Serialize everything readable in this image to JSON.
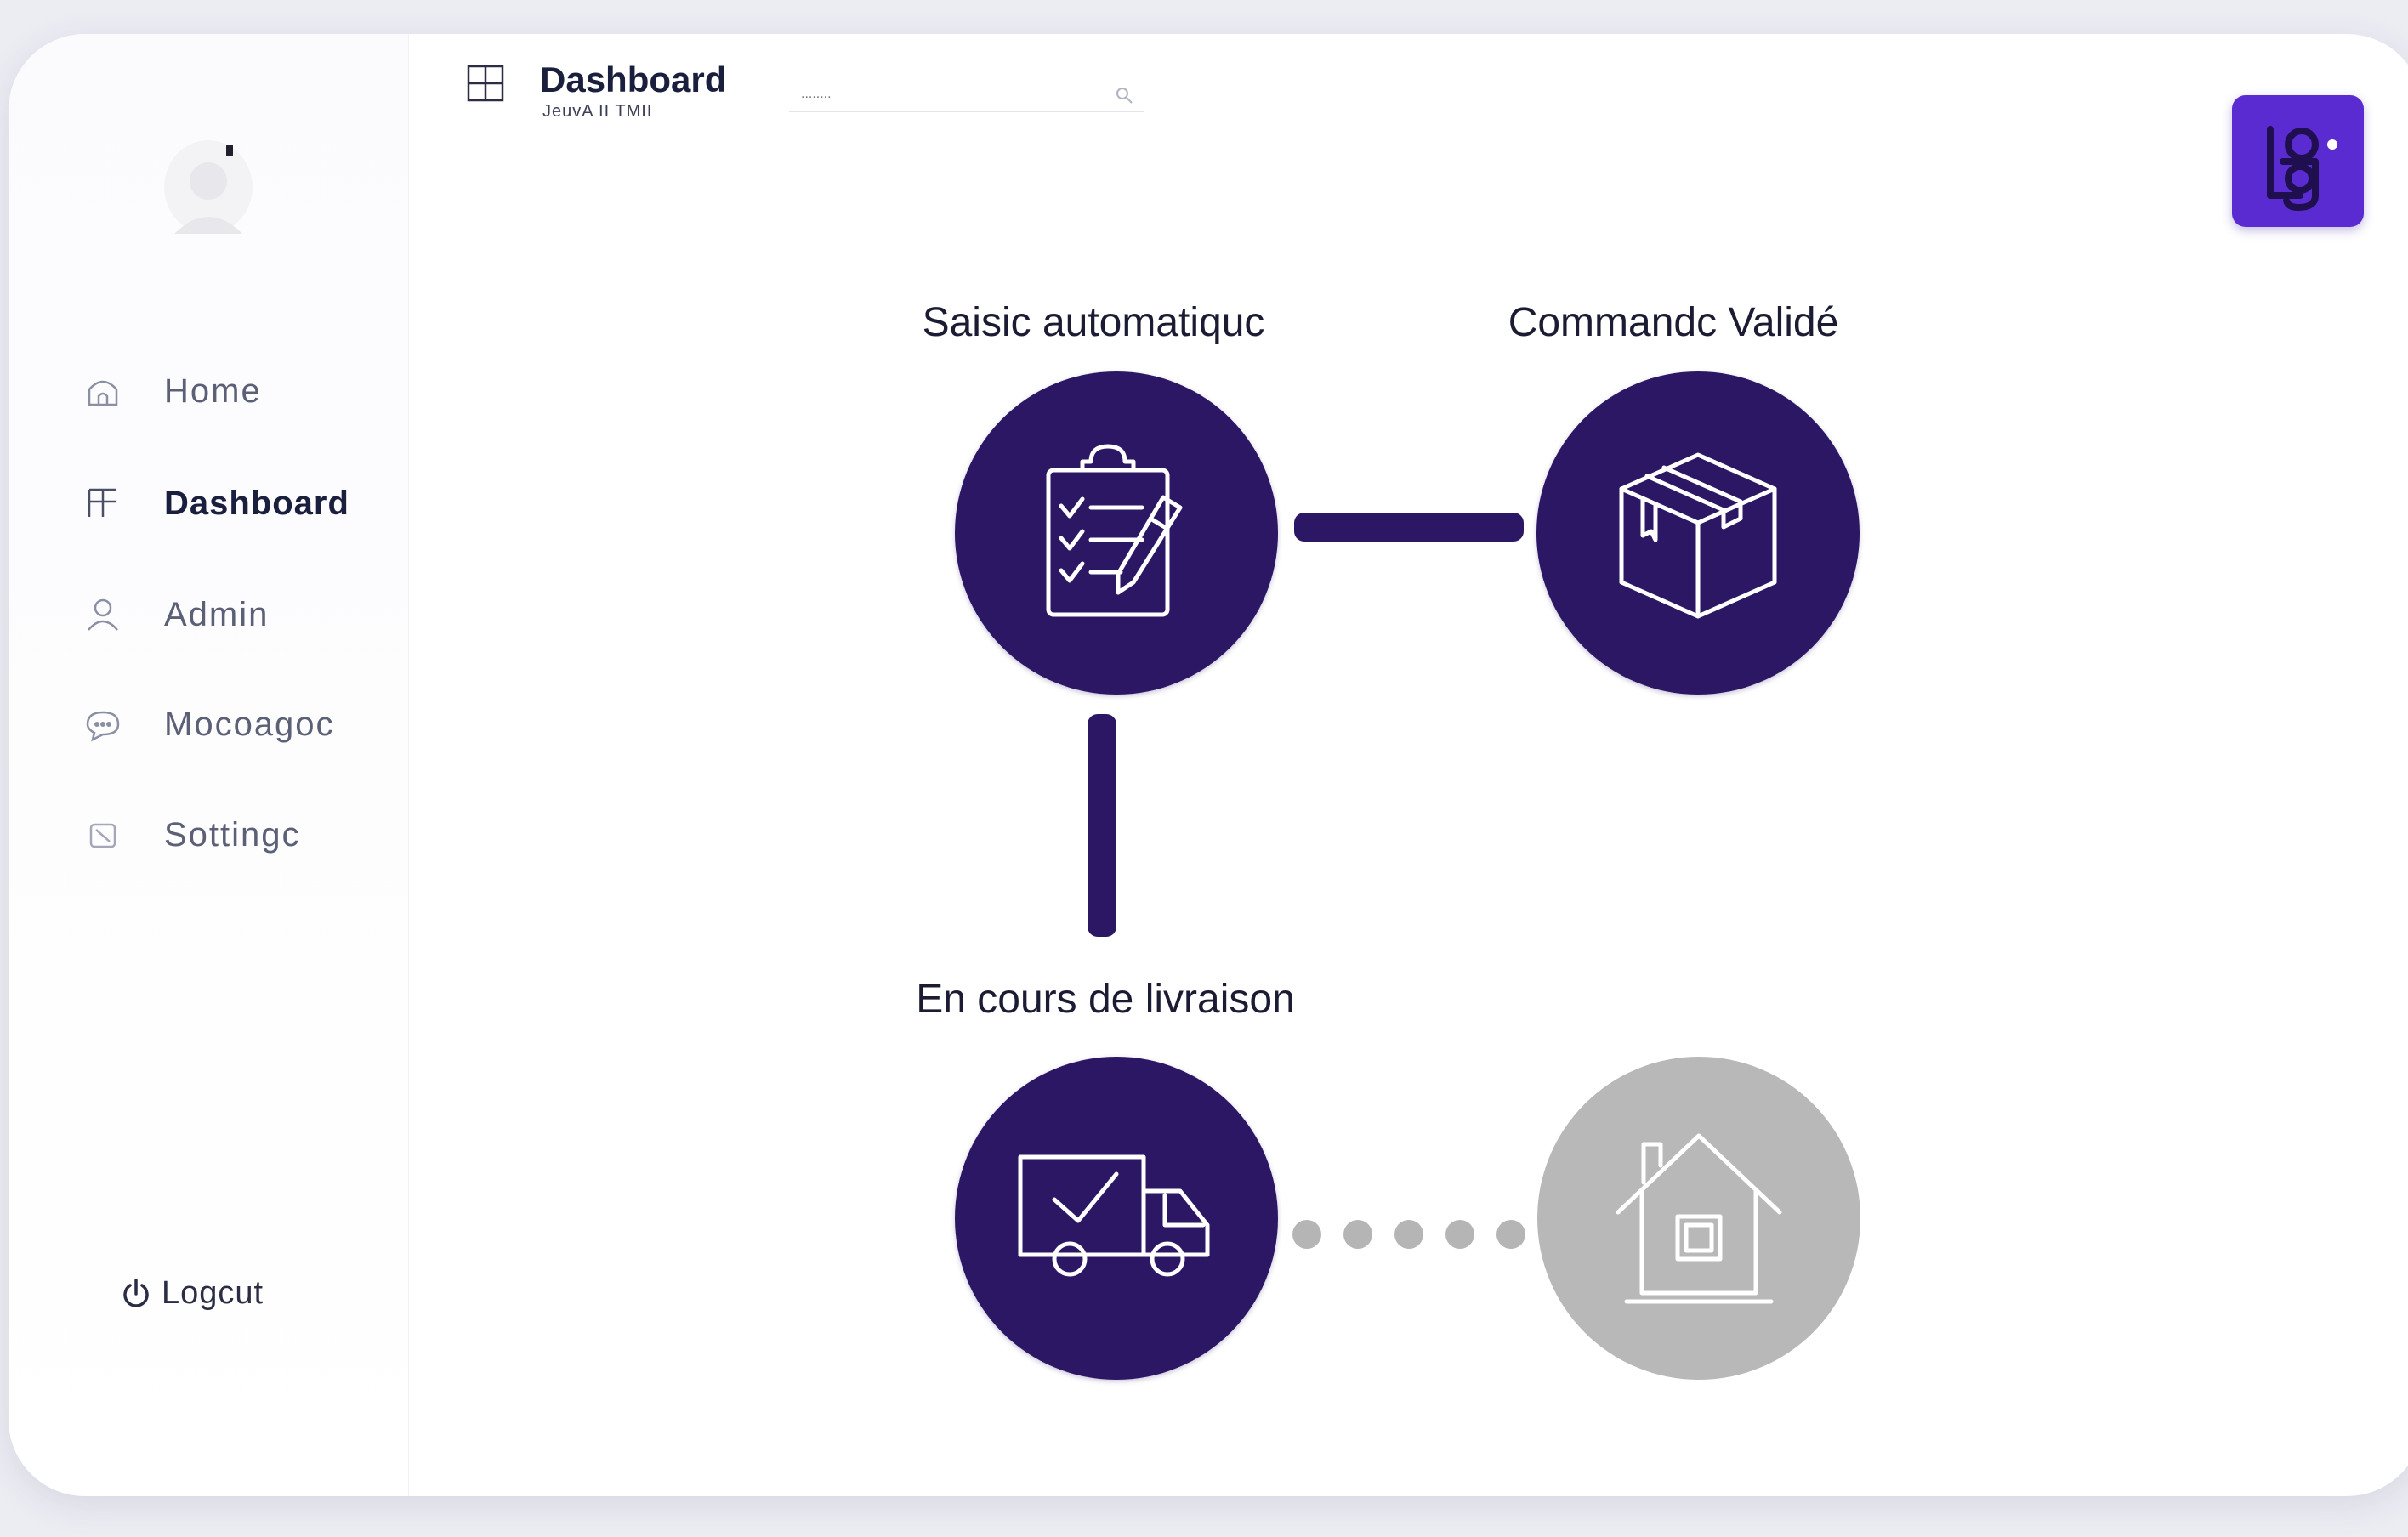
{
  "header": {
    "title": "Dashboard",
    "subtitle": "JeuvA II TMII",
    "search_placeholder": "........"
  },
  "sidebar": {
    "items": [
      {
        "label": "Home",
        "icon": "home-icon"
      },
      {
        "label": "Dashboard",
        "icon": "dashboard-grid-icon",
        "active": true
      },
      {
        "label": "Admin",
        "icon": "user-icon"
      },
      {
        "label": "Mocoagoc",
        "icon": "chat-bubble-icon"
      },
      {
        "label": "Sottingc",
        "icon": "settings-icon"
      }
    ],
    "logout_label": "Logcut"
  },
  "tracker": {
    "steps": [
      {
        "label": "Saisic automatiquc",
        "icon": "clipboard-checklist-icon",
        "status": "done"
      },
      {
        "label": "Commandc Validé",
        "icon": "package-box-icon",
        "status": "done"
      },
      {
        "label": "En cours de livraison",
        "icon": "delivery-truck-icon",
        "status": "current"
      },
      {
        "label": "",
        "icon": "house-icon",
        "status": "pending"
      }
    ]
  },
  "colors": {
    "accent": "#2c1764",
    "brand": "#5a2bd0",
    "pending": "#b8b8b8",
    "text_dark": "#1a1f3d"
  }
}
